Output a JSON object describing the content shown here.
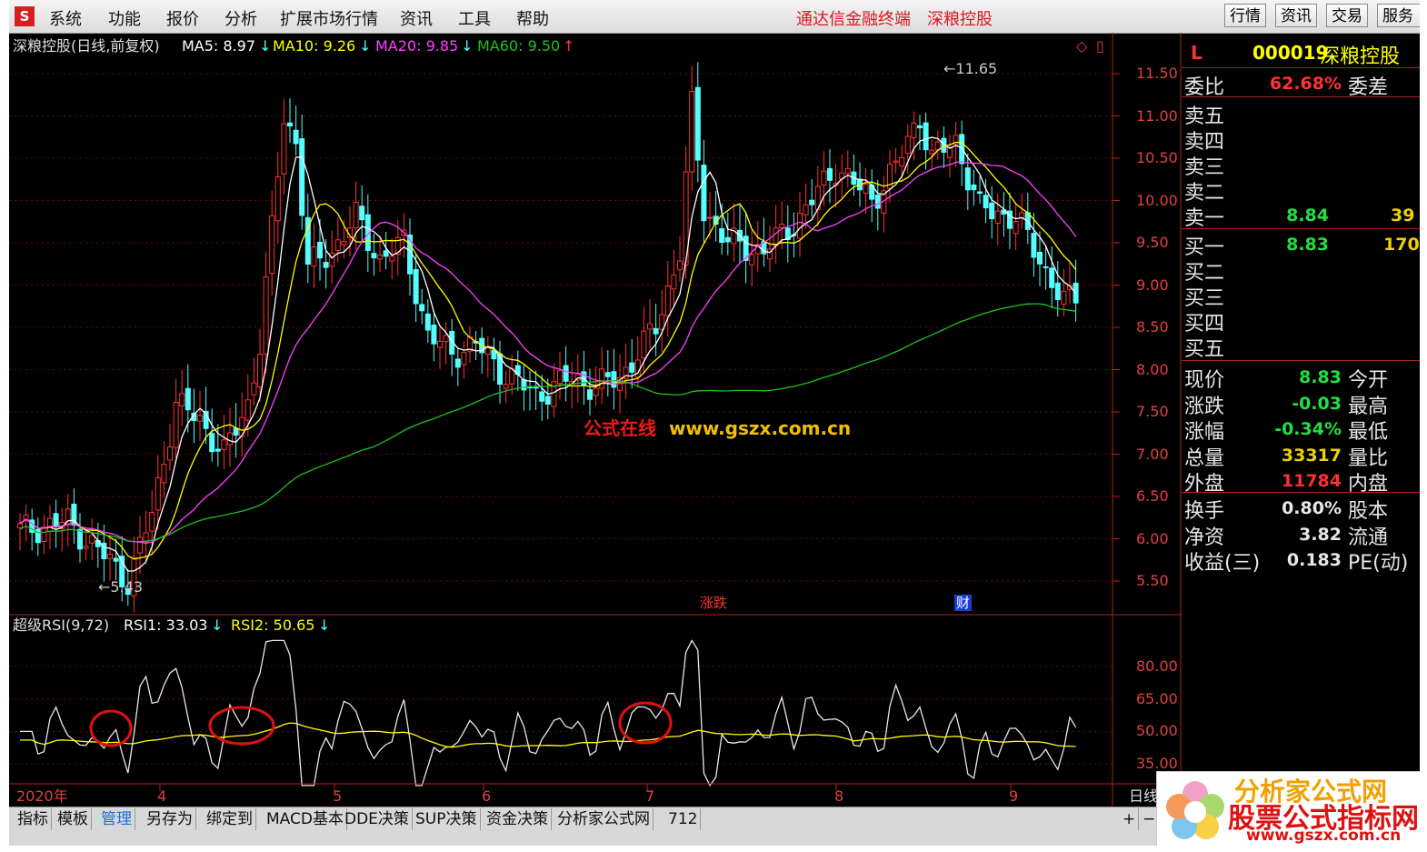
{
  "menu": [
    "系统",
    "功能",
    "报价",
    "分析",
    "扩展市场行情",
    "资讯",
    "工具",
    "帮助"
  ],
  "app_title": "通达信金融终端",
  "stock_title": "深粮控股",
  "right_buttons": [
    "行情",
    "资讯",
    "交易",
    "服务"
  ],
  "price_chart": {
    "name": "深粮控股(日线,前复权)",
    "ma5": "MA5: 8.97",
    "ma10": "MA10: 9.26",
    "ma20": "MA20: 9.85",
    "ma60": "MA60: 9.50",
    "y_ticks": [
      "11.50",
      "11.00",
      "10.50",
      "10.00",
      "9.50",
      "9.00",
      "8.50",
      "8.00",
      "7.50",
      "7.00",
      "6.50",
      "6.00",
      "5.50"
    ],
    "high_label": "11.65",
    "low_label": "5.43",
    "tag_zd": "涨跌",
    "tag_cai": "财"
  },
  "rsi": {
    "name": "超级RSI(9,72)",
    "rsi1": "RSI1: 33.03",
    "rsi2": "RSI2: 50.65",
    "y_ticks": [
      "80.00",
      "65.00",
      "50.00",
      "35.00"
    ]
  },
  "x_ticks": [
    "2020年",
    "4",
    "5",
    "6",
    "7",
    "8",
    "9"
  ],
  "x_tick_right": "日线",
  "quote": {
    "code_prefix": "L",
    "code": "000019",
    "name": "深粮控股",
    "weibi_label": "委比",
    "weibi_value": "62.68%",
    "weicha_label": "委差",
    "sell_labels": [
      "卖五",
      "卖四",
      "卖三",
      "卖二",
      "卖一"
    ],
    "sell1_price": "8.84",
    "sell1_vol": "39",
    "buy_labels": [
      "买一",
      "买二",
      "买三",
      "买四",
      "买五"
    ],
    "buy1_price": "8.83",
    "buy1_vol": "170",
    "rows": [
      {
        "k": "现价",
        "v": "8.83",
        "k2": "今开",
        "color": "#20e040"
      },
      {
        "k": "涨跌",
        "v": "-0.03",
        "k2": "最高",
        "color": "#20e040"
      },
      {
        "k": "涨幅",
        "v": "-0.34%",
        "k2": "最低",
        "color": "#20e040"
      },
      {
        "k": "总量",
        "v": "33317",
        "k2": "量比",
        "color": "#f0d000"
      },
      {
        "k": "外盘",
        "v": "11784",
        "k2": "内盘",
        "color": "#ff3030"
      }
    ],
    "rows2": [
      {
        "k": "换手",
        "v": "0.80%",
        "k2": "股本"
      },
      {
        "k": "净资",
        "v": "3.82",
        "k2": "流通"
      },
      {
        "k": "收益(三)",
        "v": "0.183",
        "k2": "PE(动)"
      }
    ]
  },
  "tabs": [
    "指标",
    "模板",
    "管理",
    "另存为",
    "绑定到",
    "MACD基本",
    "DDE决策",
    "SUP决策",
    "资金决策",
    "分析家公式网",
    "712"
  ],
  "watermark": {
    "center_cn": "公式在线",
    "center_url": "www.gszx.com.cn",
    "badge_top": "分析家公式网",
    "badge_main": "股票公式指标网",
    "badge_url": "www.gszx.com.cn"
  },
  "colors": {
    "up": "#ff3232",
    "down": "#54ffff",
    "ma5": "#ffffff",
    "ma10": "#ffff00",
    "ma20": "#ff40ff",
    "ma60": "#20c020",
    "grid": "#7a0000",
    "axis_text": "#e04040"
  }
}
